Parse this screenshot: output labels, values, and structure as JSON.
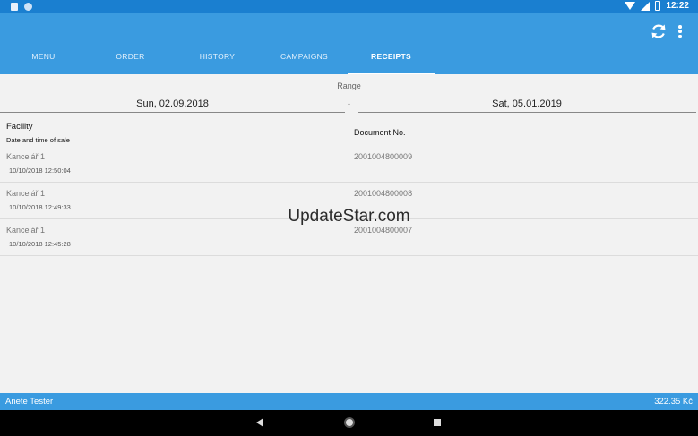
{
  "status_bar": {
    "time": "12:22"
  },
  "app_bar": {
    "refresh_icon": "refresh-icon",
    "more_icon": "more-vert-icon"
  },
  "tabs": [
    {
      "label": "MENU",
      "active": false
    },
    {
      "label": "ORDER",
      "active": false
    },
    {
      "label": "HISTORY",
      "active": false
    },
    {
      "label": "CAMPAIGNS",
      "active": false
    },
    {
      "label": "RECEIPTS",
      "active": true
    }
  ],
  "filter": {
    "range_label": "Range",
    "date_from": "Sun, 02.09.2018",
    "separator": "-",
    "date_to": "Sat, 05.01.2019"
  },
  "table": {
    "header_facility": "Facility",
    "header_date": "Date and time of sale",
    "header_document": "Document No.",
    "rows": [
      {
        "facility": "Kancelář 1",
        "datetime": "10/10/2018 12:50:04",
        "document_no": "2001004800009"
      },
      {
        "facility": "Kancelář 1",
        "datetime": "10/10/2018 12:49:33",
        "document_no": "2001004800008"
      },
      {
        "facility": "Kancelář 1",
        "datetime": "10/10/2018 12:45:28",
        "document_no": "2001004800007"
      }
    ]
  },
  "watermark": "UpdateStar.com",
  "footer": {
    "user": "Anete Tester",
    "total": "322.35 Kč"
  },
  "colors": {
    "primary": "#3a9be0",
    "status_bar": "#1a7fd0",
    "background": "#f2f2f2"
  }
}
